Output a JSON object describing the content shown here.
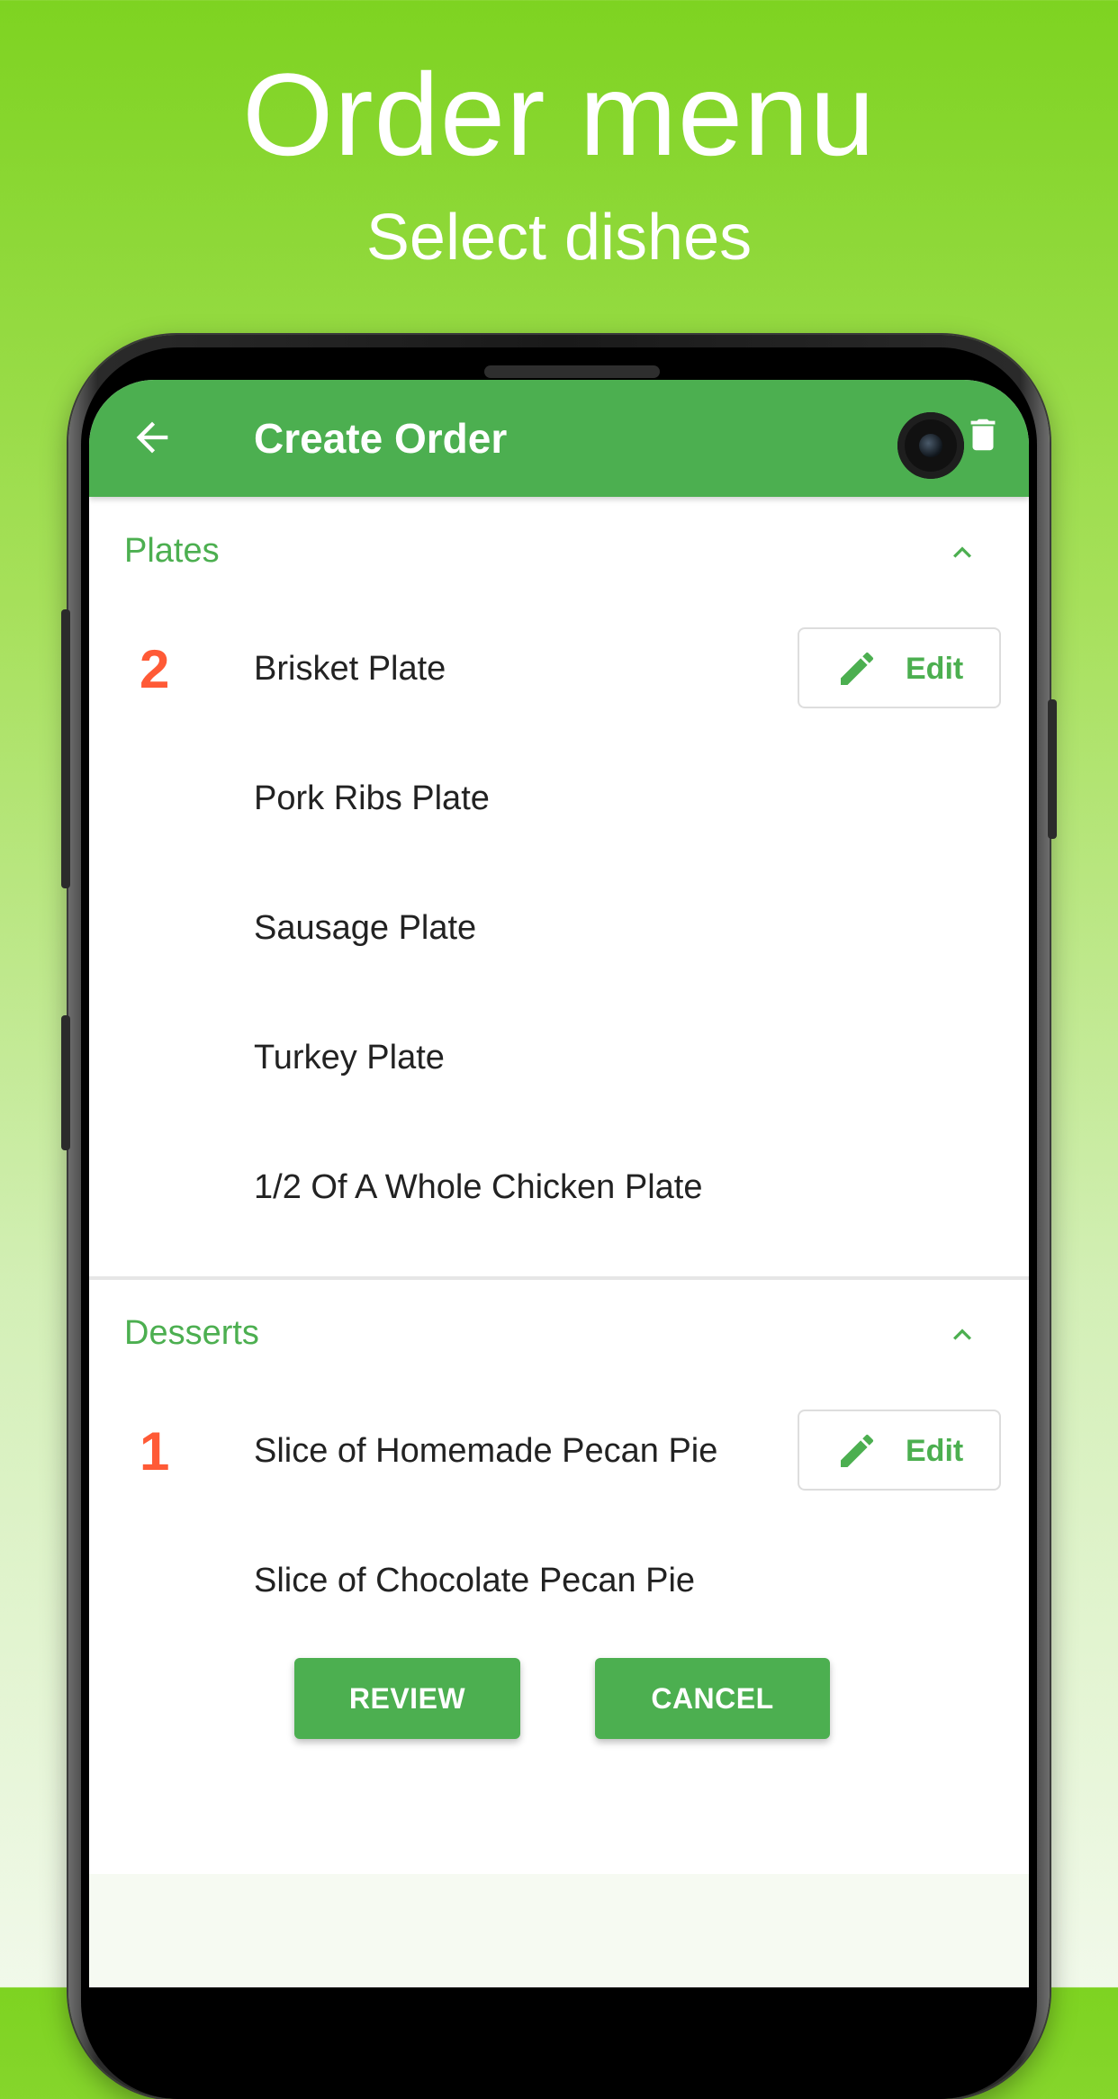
{
  "promo": {
    "title": "Order menu",
    "subtitle": "Select dishes"
  },
  "app_bar": {
    "title": "Create Order",
    "back_icon": "arrow-left-icon",
    "delete_icon": "trash-icon",
    "color": "#4caf50"
  },
  "sections": [
    {
      "label": "Plates",
      "expanded": true,
      "items": [
        {
          "qty": "2",
          "name": "Brisket Plate",
          "edit_label": "Edit"
        },
        {
          "qty": "",
          "name": "Pork Ribs Plate"
        },
        {
          "qty": "",
          "name": "Sausage Plate"
        },
        {
          "qty": "",
          "name": "Turkey Plate"
        },
        {
          "qty": "",
          "name": "1/2 Of A Whole Chicken Plate"
        }
      ]
    },
    {
      "label": "Desserts",
      "expanded": true,
      "items": [
        {
          "qty": "1",
          "name": "Slice of Homemade Pecan Pie",
          "edit_label": "Edit"
        },
        {
          "qty": "",
          "name": "Slice of Chocolate Pecan Pie"
        }
      ]
    }
  ],
  "actions": {
    "review_label": "REVIEW",
    "cancel_label": "CANCEL"
  },
  "colors": {
    "accent": "#4caf50",
    "quantity": "#ff5a36",
    "background_top": "#7ed321"
  }
}
